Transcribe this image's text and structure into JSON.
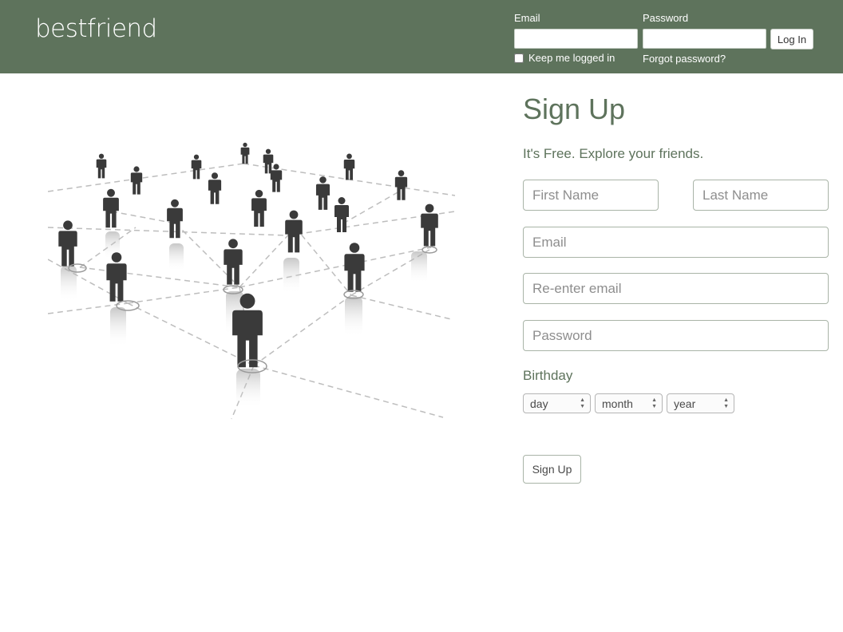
{
  "header": {
    "logo": "bestfriend",
    "email_label": "Email",
    "password_label": "Password",
    "login_label": "Log In",
    "keep_logged_in": "Keep me logged in",
    "forgot_password": "Forgot password?"
  },
  "signup": {
    "title": "Sign Up",
    "subtitle": "It's Free. Explore your friends.",
    "first_name_placeholder": "First Name",
    "last_name_placeholder": "Last Name",
    "email_placeholder": "Email",
    "reenter_email_placeholder": "Re-enter email",
    "password_placeholder": "Password",
    "birthday_label": "Birthday",
    "day": "day",
    "month": "month",
    "year": "year",
    "button": "Sign Up"
  },
  "colors": {
    "header_bg": "#5e735c",
    "accent_text": "#5e735c"
  },
  "illustration": {
    "icon": "people-network-icon"
  }
}
